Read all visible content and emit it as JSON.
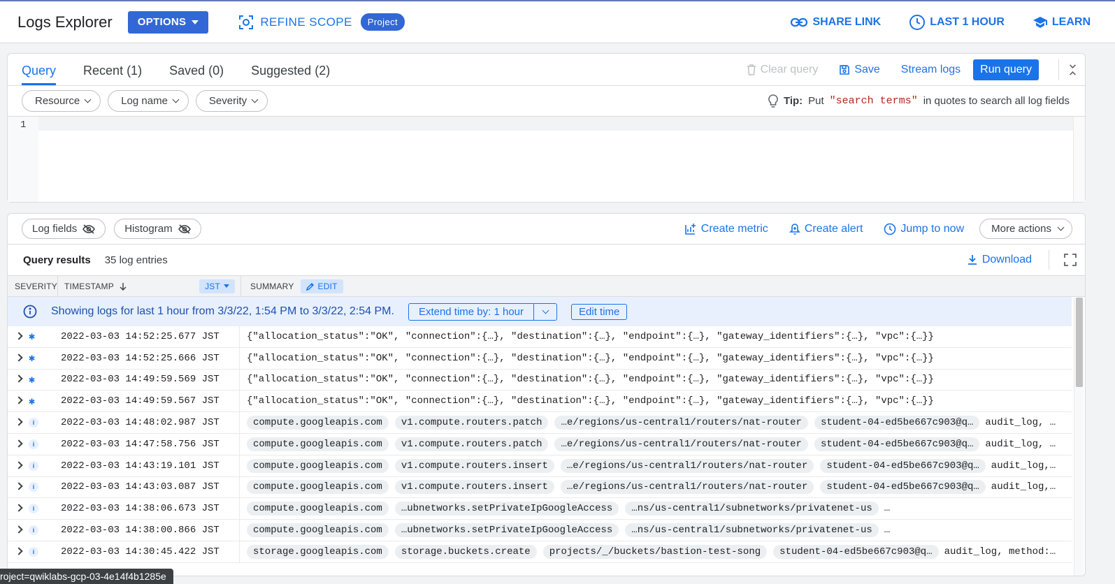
{
  "header": {
    "title": "Logs Explorer",
    "options_label": "OPTIONS",
    "refine_scope_label": "REFINE SCOPE",
    "scope_badge": "Project",
    "share_link_label": "SHARE LINK",
    "time_range_label": "LAST 1 HOUR",
    "learn_label": "LEARN"
  },
  "query": {
    "tabs": [
      "Query",
      "Recent (1)",
      "Saved (0)",
      "Suggested (2)"
    ],
    "clear_label": "Clear query",
    "save_label": "Save",
    "stream_label": "Stream logs",
    "run_label": "Run query",
    "filters": [
      "Resource",
      "Log name",
      "Severity"
    ],
    "tip_prefix": "Tip:",
    "tip_text_1": "Put",
    "tip_code": "\"search terms\"",
    "tip_text_2": "in quotes to search all log fields",
    "line_number": "1"
  },
  "results": {
    "log_fields_label": "Log fields",
    "histogram_label": "Histogram",
    "create_metric_label": "Create metric",
    "create_alert_label": "Create alert",
    "jump_label": "Jump to now",
    "more_actions_label": "More actions",
    "title": "Query results",
    "count": "35 log entries",
    "download_label": "Download",
    "columns": {
      "severity": "SEVERITY",
      "timestamp": "TIMESTAMP",
      "tz": "JST",
      "summary": "SUMMARY",
      "edit": "EDIT"
    },
    "banner_text": "Showing logs for last 1 hour from 3/3/22, 1:54 PM to 3/3/22, 2:54 PM.",
    "extend_label": "Extend time by: 1 hour",
    "edit_time_label": "Edit time",
    "rows": [
      {
        "sev": "default",
        "ts": "2022-03-03 14:52:25.677 JST",
        "text": "{\"allocation_status\":\"OK\", \"connection\":{…}, \"destination\":{…}, \"endpoint\":{…}, \"gateway_identifiers\":{…}, \"vpc\":{…}}"
      },
      {
        "sev": "default",
        "ts": "2022-03-03 14:52:25.666 JST",
        "text": "{\"allocation_status\":\"OK\", \"connection\":{…}, \"destination\":{…}, \"endpoint\":{…}, \"gateway_identifiers\":{…}, \"vpc\":{…}}"
      },
      {
        "sev": "default",
        "ts": "2022-03-03 14:49:59.569 JST",
        "text": "{\"allocation_status\":\"OK\", \"connection\":{…}, \"destination\":{…}, \"endpoint\":{…}, \"gateway_identifiers\":{…}, \"vpc\":{…}}"
      },
      {
        "sev": "default",
        "ts": "2022-03-03 14:49:59.567 JST",
        "text": "{\"allocation_status\":\"OK\", \"connection\":{…}, \"destination\":{…}, \"endpoint\":{…}, \"gateway_identifiers\":{…}, \"vpc\":{…}}"
      },
      {
        "sev": "info",
        "ts": "2022-03-03 14:48:02.987 JST",
        "tags": [
          "compute.googleapis.com",
          "v1.compute.routers.patch",
          "…e/regions/us-central1/routers/nat-router",
          "student-04-ed5be667c903@q…"
        ],
        "trail": "audit_log, …"
      },
      {
        "sev": "info",
        "ts": "2022-03-03 14:47:58.756 JST",
        "tags": [
          "compute.googleapis.com",
          "v1.compute.routers.patch",
          "…e/regions/us-central1/routers/nat-router",
          "student-04-ed5be667c903@q…"
        ],
        "trail": "audit_log, …"
      },
      {
        "sev": "info",
        "ts": "2022-03-03 14:43:19.101 JST",
        "tags": [
          "compute.googleapis.com",
          "v1.compute.routers.insert",
          "…e/regions/us-central1/routers/nat-router",
          "student-04-ed5be667c903@q…"
        ],
        "trail": "audit_log,…"
      },
      {
        "sev": "info",
        "ts": "2022-03-03 14:43:03.087 JST",
        "tags": [
          "compute.googleapis.com",
          "v1.compute.routers.insert",
          "…e/regions/us-central1/routers/nat-router",
          "student-04-ed5be667c903@q…"
        ],
        "trail": "audit_log,…"
      },
      {
        "sev": "info",
        "ts": "2022-03-03 14:38:06.673 JST",
        "tags": [
          "compute.googleapis.com",
          "…ubnetworks.setPrivateIpGoogleAccess",
          "…ns/us-central1/subnetworks/privatenet-us"
        ],
        "trail": "…"
      },
      {
        "sev": "info",
        "ts": "2022-03-03 14:38:00.866 JST",
        "tags": [
          "compute.googleapis.com",
          "…ubnetworks.setPrivateIpGoogleAccess",
          "…ns/us-central1/subnetworks/privatenet-us"
        ],
        "trail": "…"
      },
      {
        "sev": "info",
        "ts": "2022-03-03 14:30:45.422 JST",
        "tags": [
          "storage.googleapis.com",
          "storage.buckets.create",
          "projects/_/buckets/bastion-test-song",
          "student-04-ed5be667c903@q…"
        ],
        "trail": "audit_log, method:…"
      }
    ]
  },
  "status_bar": "roject=qwiklabs-gcp-03-4e14f4b1285e",
  "colors": {
    "accent": "#1a73e8",
    "button": "#3367d6",
    "banner": "#e8f0fe"
  }
}
